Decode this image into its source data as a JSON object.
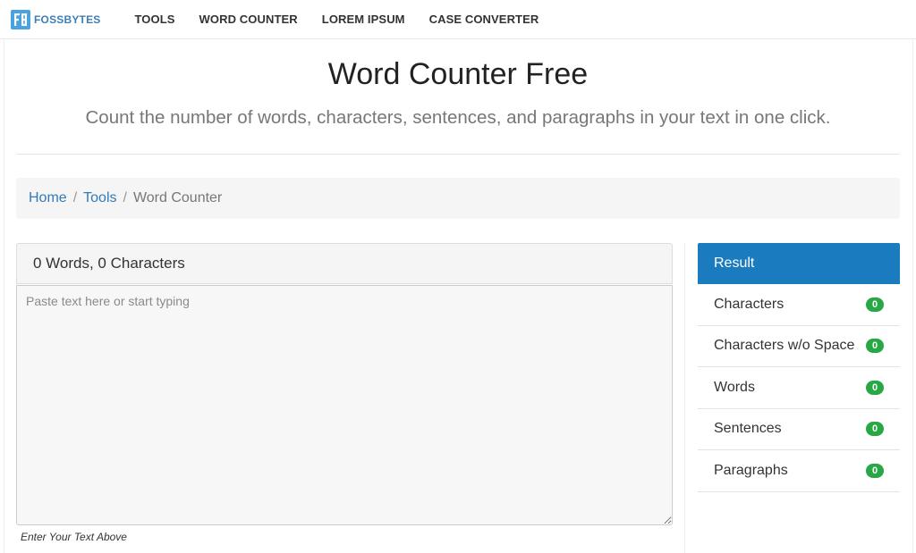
{
  "brand": {
    "name": "FOSSBYTES",
    "logo_icon": "fossbytes-logo-icon",
    "color": "#3d7eb6"
  },
  "nav": {
    "items": [
      {
        "label": "TOOLS"
      },
      {
        "label": "WORD COUNTER"
      },
      {
        "label": "LOREM IPSUM"
      },
      {
        "label": "CASE CONVERTER"
      }
    ]
  },
  "hero": {
    "title": "Word Counter Free",
    "subtitle": "Count the number of words, characters, sentences, and paragraphs in your text in one click."
  },
  "breadcrumb": {
    "items": [
      {
        "label": "Home"
      },
      {
        "label": "Tools"
      },
      {
        "label": "Word Counter"
      }
    ],
    "separator": "/"
  },
  "editor": {
    "summary": "0 Words, 0 Characters",
    "value": "",
    "placeholder": "Paste text here or start typing",
    "hint": "Enter Your Text Above"
  },
  "results": {
    "title": "Result",
    "accent_color": "#1b7bbf",
    "badge_color": "#28a745",
    "rows": [
      {
        "label": "Characters",
        "value": "0"
      },
      {
        "label": "Characters w/o Space",
        "value": "0"
      },
      {
        "label": "Words",
        "value": "0"
      },
      {
        "label": "Sentences",
        "value": "0"
      },
      {
        "label": "Paragraphs",
        "value": "0"
      }
    ]
  }
}
